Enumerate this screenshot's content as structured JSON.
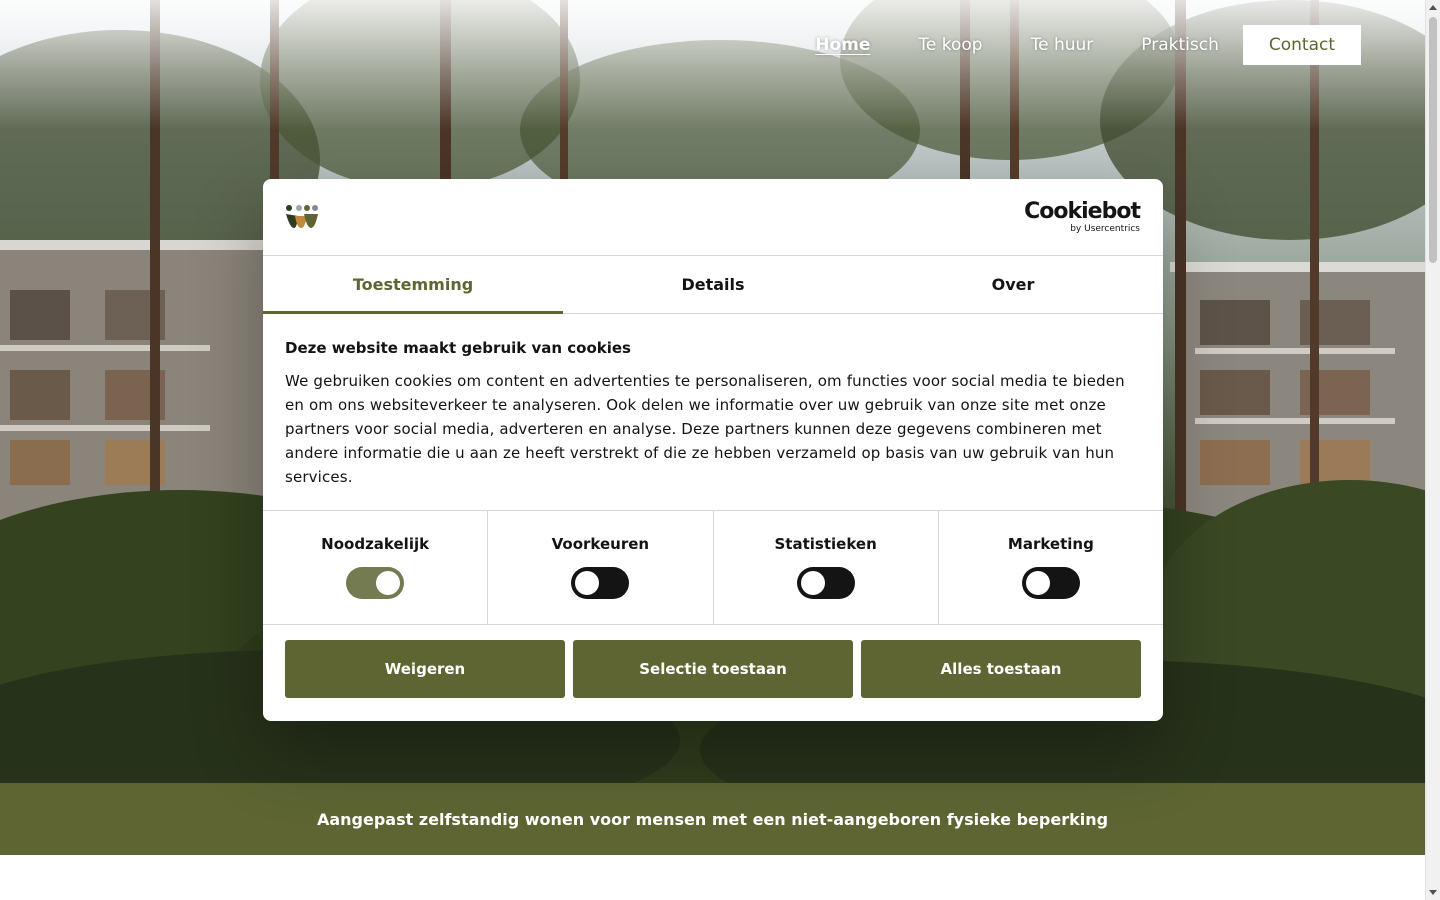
{
  "nav": {
    "items": [
      {
        "label": "Home",
        "active": true
      },
      {
        "label": "Te koop"
      },
      {
        "label": "Te huur"
      },
      {
        "label": "Praktisch"
      }
    ],
    "contact_label": "Contact"
  },
  "tagline": "Aangepast zelfstandig wonen voor mensen met een niet-aangeboren fysieke beperking",
  "cookie_dialog": {
    "provider_logo": {
      "name": "Cookiebot",
      "subtitle": "by Usercentrics"
    },
    "tabs": [
      {
        "label": "Toestemming",
        "active": true
      },
      {
        "label": "Details"
      },
      {
        "label": "Over"
      }
    ],
    "title": "Deze website maakt gebruik van cookies",
    "body": "We gebruiken cookies om content en advertenties te personaliseren, om functies voor social media te bieden en om ons websiteverkeer te analyseren. Ook delen we informatie over uw gebruik van onze site met onze partners voor social media, adverteren en analyse. Deze partners kunnen deze gegevens combineren met andere informatie die u aan ze heeft verstrekt of die ze hebben verzameld op basis van uw gebruik van hun services.",
    "toggles": [
      {
        "label": "Noodzakelijk",
        "checked": true
      },
      {
        "label": "Voorkeuren",
        "checked": false
      },
      {
        "label": "Statistieken",
        "checked": false
      },
      {
        "label": "Marketing",
        "checked": false
      }
    ],
    "buttons": {
      "decline": "Weigeren",
      "allow_selection": "Selectie toestaan",
      "allow_all": "Alles toestaan"
    }
  },
  "colors": {
    "brand_green": "#5e6533",
    "text_dark": "#141414"
  }
}
